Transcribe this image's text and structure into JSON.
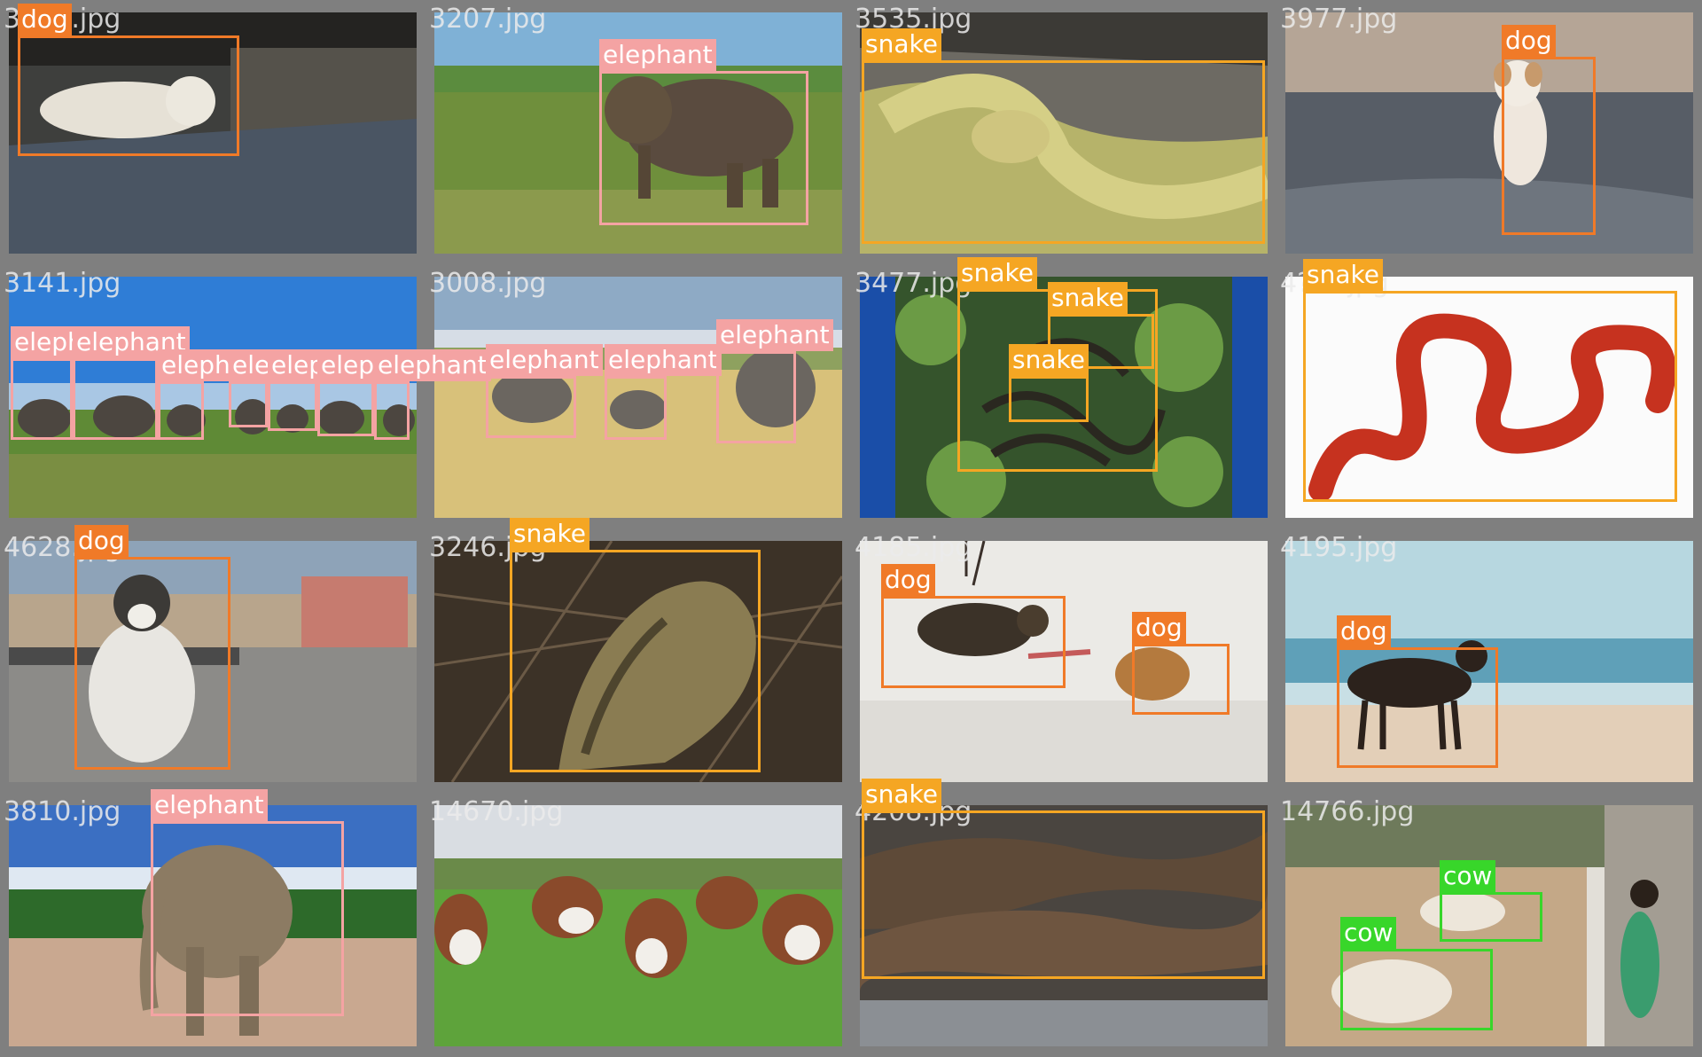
{
  "colors": {
    "dog": "#f07a28",
    "elephant": "#f4a3a3",
    "snake": "#f5a623",
    "cow": "#38d62a"
  },
  "tiles": [
    {
      "file": "3116.jpg",
      "scene": "dog-sleeping-dark-street",
      "detections": [
        {
          "label": "dog"
        }
      ]
    },
    {
      "file": "3207.jpg",
      "scene": "elephant-savanna",
      "detections": [
        {
          "label": "elephant"
        }
      ]
    },
    {
      "file": "3535.jpg",
      "scene": "rattlesnake-on-rocks",
      "detections": [
        {
          "label": "snake"
        }
      ]
    },
    {
      "file": "3977.jpg",
      "scene": "puppy-on-gravel",
      "detections": [
        {
          "label": "dog"
        }
      ]
    },
    {
      "file": "3141.jpg",
      "scene": "elephant-herd-blue-sky",
      "detections": [
        {
          "label": "elephant"
        },
        {
          "label": "elephant"
        },
        {
          "label": "elephant"
        },
        {
          "label": "elephant"
        },
        {
          "label": "elephant"
        },
        {
          "label": "elephant"
        },
        {
          "label": "elephant"
        }
      ]
    },
    {
      "file": "3008.jpg",
      "scene": "elephants-dry-grass",
      "detections": [
        {
          "label": "elephant"
        },
        {
          "label": "elephant"
        },
        {
          "label": "elephant"
        }
      ]
    },
    {
      "file": "3477.jpg",
      "scene": "snakes-in-plants",
      "detections": [
        {
          "label": "snake"
        },
        {
          "label": "snake"
        },
        {
          "label": "snake"
        }
      ]
    },
    {
      "file": "4???.jpg",
      "scene": "red-snake-white-background",
      "detections": [
        {
          "label": "snake"
        }
      ]
    },
    {
      "file": "4628.jpg",
      "scene": "husky-on-train-platform",
      "detections": [
        {
          "label": "dog"
        }
      ]
    },
    {
      "file": "3246.jpg",
      "scene": "python-in-brush",
      "detections": [
        {
          "label": "snake"
        }
      ]
    },
    {
      "file": "4185.jpg",
      "scene": "dogs-in-snow",
      "detections": [
        {
          "label": "dog"
        },
        {
          "label": "dog"
        }
      ]
    },
    {
      "file": "4195.jpg",
      "scene": "dog-on-beach",
      "detections": [
        {
          "label": "dog"
        }
      ]
    },
    {
      "file": "3810.jpg",
      "scene": "elephant-on-sand",
      "detections": [
        {
          "label": "elephant"
        }
      ]
    },
    {
      "file": "14670.jpg",
      "scene": "cows-in-pasture",
      "detections": []
    },
    {
      "file": "4208.jpg",
      "scene": "brown-snake-closeup",
      "detections": [
        {
          "label": "snake"
        }
      ]
    },
    {
      "file": "14766.jpg",
      "scene": "cows-by-roadside-with-girl",
      "detections": [
        {
          "label": "cow"
        },
        {
          "label": "cow"
        }
      ]
    }
  ]
}
